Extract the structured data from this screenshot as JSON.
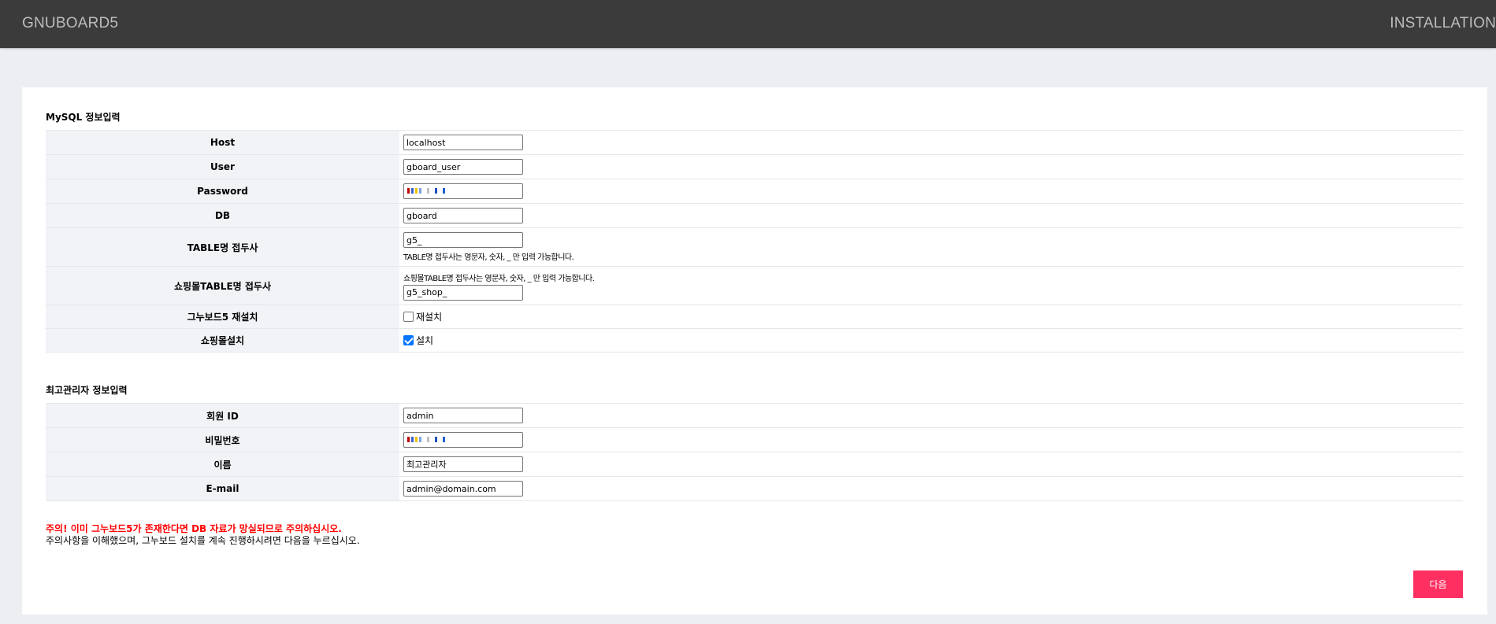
{
  "header": {
    "brand": "GNUBOARD5",
    "right_label": "INSTALLATION"
  },
  "mysql": {
    "title": "MySQL 정보입력",
    "host_label": "Host",
    "host_value": "localhost",
    "user_label": "User",
    "user_value": "gboard_user",
    "password_label": "Password",
    "db_label": "DB",
    "db_value": "gboard",
    "table_prefix_label": "TABLE명 접두사",
    "table_prefix_value": "g5_",
    "table_prefix_help": "TABLE명 접두사는 영문자, 숫자, _ 만 입력 가능합니다.",
    "shop_prefix_label": "쇼핑몰TABLE명 접두사",
    "shop_prefix_help": "쇼핑몰TABLE명 접두사는 영문자, 숫자, _ 만 입력 가능합니다.",
    "shop_prefix_value": "g5_shop_",
    "reinstall_label": "그누보드5 재설치",
    "reinstall_checkbox_label": "재설치",
    "reinstall_checked": false,
    "shop_install_label": "쇼핑몰설치",
    "shop_install_checkbox_label": "설치",
    "shop_install_checked": true
  },
  "admin": {
    "title": "최고관리자 정보입력",
    "id_label": "회원 ID",
    "id_value": "admin",
    "password_label": "비밀번호",
    "name_label": "이름",
    "name_value": "최고관리자",
    "email_label": "E-mail",
    "email_value": "admin@domain.com"
  },
  "warning": {
    "red": "주의! 이미 그누보드5가 존재한다면 DB 자료가 망실되므로 주의하십시오.",
    "normal": "주의사항을 이해했으며, 그누보드 설치를 계속 진행하시려면 다음을 누르십시오."
  },
  "next_button": "다음"
}
